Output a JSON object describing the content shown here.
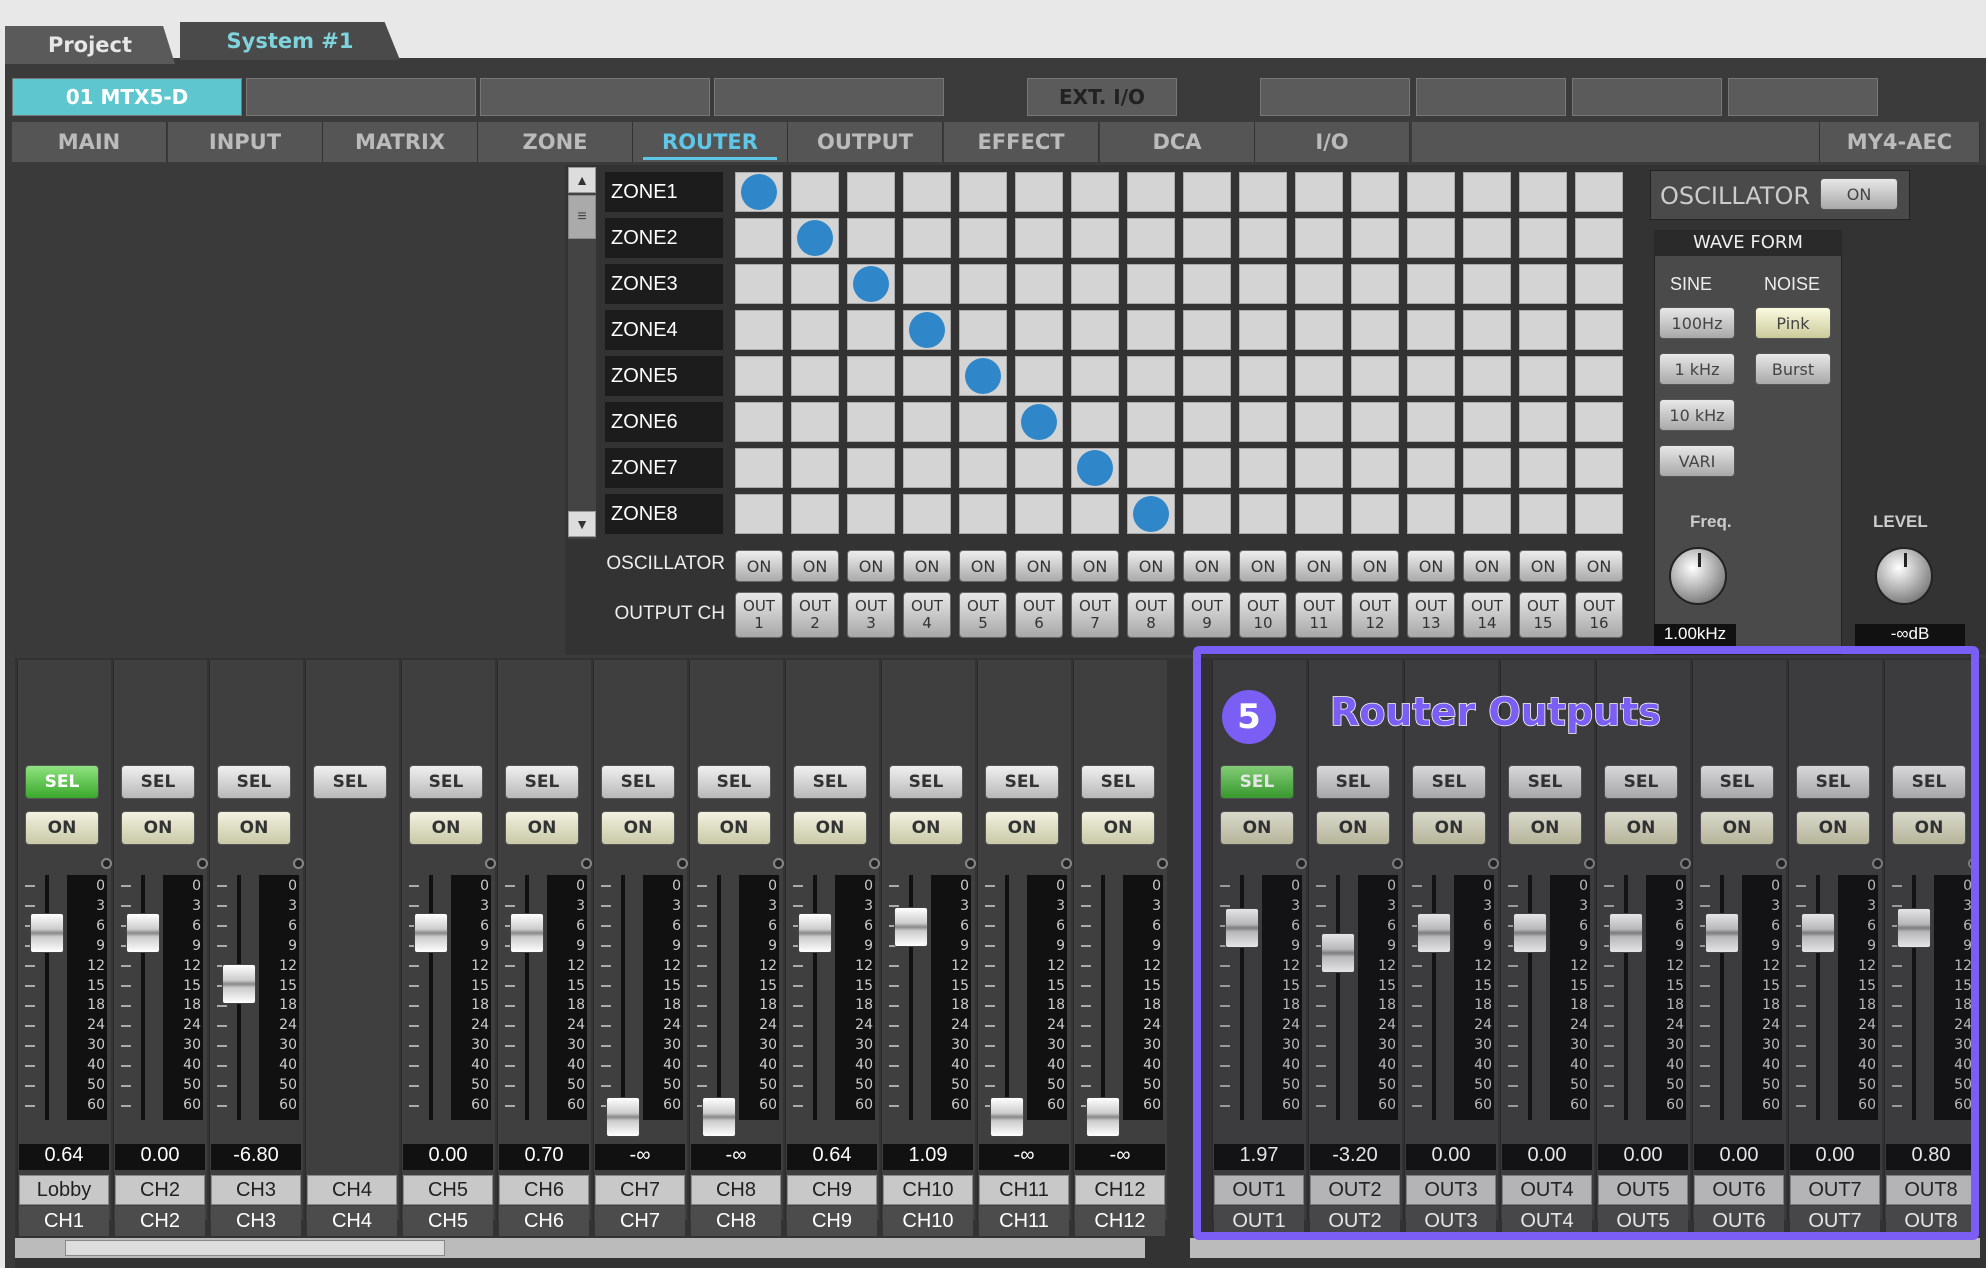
{
  "tabs": {
    "project": "Project",
    "system": "System #1"
  },
  "device_tabs": [
    "01 MTX5-D",
    "",
    "",
    "",
    "EXT. I/O",
    "",
    "",
    "",
    ""
  ],
  "sub_tabs": [
    "MAIN",
    "INPUT",
    "MATRIX",
    "ZONE",
    "ROUTER",
    "OUTPUT",
    "EFFECT",
    "DCA",
    "I/O",
    "MY4-AEC"
  ],
  "zones": [
    "ZONE1",
    "ZONE2",
    "ZONE3",
    "ZONE4",
    "ZONE5",
    "ZONE6",
    "ZONE7",
    "ZONE8"
  ],
  "routes": [
    1,
    2,
    3,
    4,
    5,
    6,
    7,
    8
  ],
  "oscillator_label": "OSCILLATOR",
  "output_ch_label": "OUTPUT CH",
  "on_label": "ON",
  "out_prefix": "OUT",
  "osc": {
    "title": "OSCILLATOR",
    "on": "ON",
    "wave_form": "WAVE FORM",
    "sine": "SINE",
    "noise": "NOISE",
    "b100": "100Hz",
    "b1k": "1 kHz",
    "b10k": "10 kHz",
    "vari": "VARI",
    "pink": "Pink",
    "burst": "Burst",
    "freq": "Freq.",
    "level": "LEVEL",
    "freq_val": "1.00kHz",
    "level_val": "-∞dB"
  },
  "scale": [
    "0",
    "3",
    "6",
    "9",
    "12",
    "15",
    "18",
    "24",
    "30",
    "40",
    "50",
    "60"
  ],
  "inputs": [
    {
      "sel": "SEL",
      "on": "ON",
      "value": "0.64",
      "name": "Lobby",
      "ch": "CH1",
      "sel_active": true
    },
    {
      "sel": "SEL",
      "on": "ON",
      "value": "0.00",
      "name": "CH2",
      "ch": "CH2"
    },
    {
      "sel": "SEL",
      "on": "ON",
      "value": "-6.80",
      "name": "CH3",
      "ch": "CH3"
    },
    {
      "sel": "SEL",
      "on": "",
      "value": "",
      "name": "CH4",
      "ch": "CH4"
    },
    {
      "sel": "SEL",
      "on": "ON",
      "value": "0.00",
      "name": "CH5",
      "ch": "CH5"
    },
    {
      "sel": "SEL",
      "on": "ON",
      "value": "0.70",
      "name": "CH6",
      "ch": "CH6"
    },
    {
      "sel": "SEL",
      "on": "ON",
      "value": "-∞",
      "name": "CH7",
      "ch": "CH7"
    },
    {
      "sel": "SEL",
      "on": "ON",
      "value": "-∞",
      "name": "CH8",
      "ch": "CH8"
    },
    {
      "sel": "SEL",
      "on": "ON",
      "value": "0.64",
      "name": "CH9",
      "ch": "CH9"
    },
    {
      "sel": "SEL",
      "on": "ON",
      "value": "1.09",
      "name": "CH10",
      "ch": "CH10"
    },
    {
      "sel": "SEL",
      "on": "ON",
      "value": "-∞",
      "name": "CH11",
      "ch": "CH11"
    },
    {
      "sel": "SEL",
      "on": "ON",
      "value": "-∞",
      "name": "CH12",
      "ch": "CH12"
    }
  ],
  "outputs": [
    {
      "sel": "SEL",
      "on": "ON",
      "value": "1.97",
      "name": "OUT1",
      "ch": "OUT1",
      "sel_active": true
    },
    {
      "sel": "SEL",
      "on": "ON",
      "value": "-3.20",
      "name": "OUT2",
      "ch": "OUT2"
    },
    {
      "sel": "SEL",
      "on": "ON",
      "value": "0.00",
      "name": "OUT3",
      "ch": "OUT3"
    },
    {
      "sel": "SEL",
      "on": "ON",
      "value": "0.00",
      "name": "OUT4",
      "ch": "OUT4"
    },
    {
      "sel": "SEL",
      "on": "ON",
      "value": "0.00",
      "name": "OUT5",
      "ch": "OUT5"
    },
    {
      "sel": "SEL",
      "on": "ON",
      "value": "0.00",
      "name": "OUT6",
      "ch": "OUT6"
    },
    {
      "sel": "SEL",
      "on": "ON",
      "value": "0.00",
      "name": "OUT7",
      "ch": "OUT7"
    },
    {
      "sel": "SEL",
      "on": "ON",
      "value": "0.80",
      "name": "OUT8",
      "ch": "OUT8"
    }
  ],
  "callout": {
    "number": "5",
    "text": "Router Outputs",
    "color": "#7b5ff4"
  }
}
